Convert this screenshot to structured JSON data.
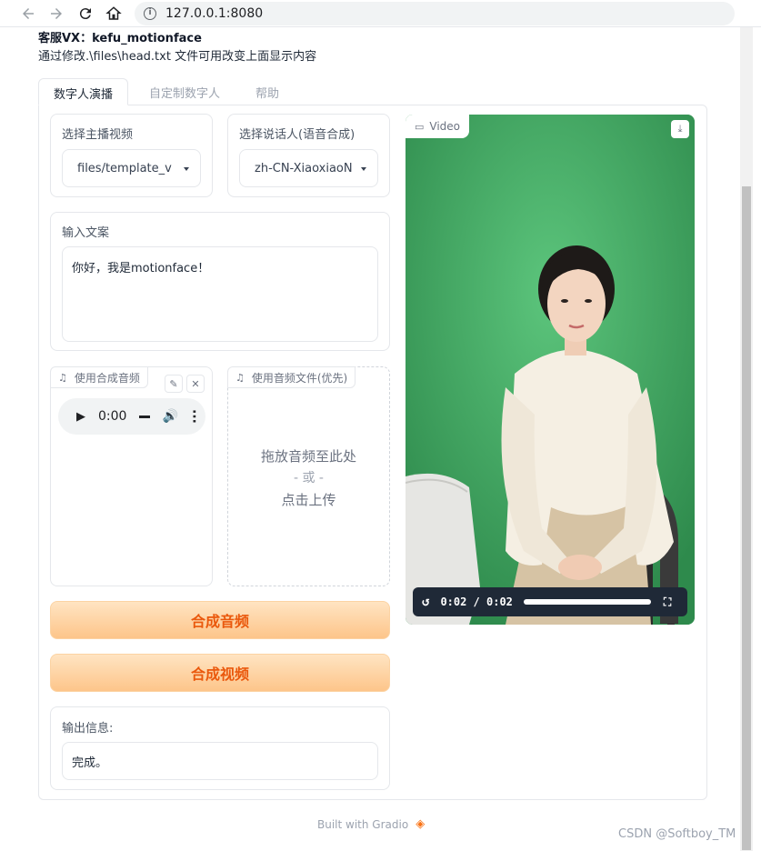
{
  "browser": {
    "url": "127.0.0.1:8080"
  },
  "header": {
    "line1": "客服VX：kefu_motionface",
    "line2": "通过修改.\\files\\head.txt 文件可用改变上面显示内容"
  },
  "tabs": [
    {
      "label": "数字人演播",
      "active": true
    },
    {
      "label": "自定制数字人",
      "active": false
    },
    {
      "label": "帮助",
      "active": false
    }
  ],
  "host_video": {
    "label": "选择主播视频",
    "value": "files/template_v"
  },
  "speaker": {
    "label": "选择说话人(语音合成)",
    "value": "zh-CN-XiaoxiaoN"
  },
  "script_input": {
    "label": "输入文案",
    "value": "你好，我是motionface！"
  },
  "synth_audio": {
    "label": "使用合成音频",
    "time": "0:00"
  },
  "upload_audio": {
    "label": "使用音频文件(优先)",
    "drop_line1": "拖放音频至此处",
    "drop_line2": "- 或 -",
    "drop_line3": "点击上传"
  },
  "buttons": {
    "synth_audio": "合成音频",
    "synth_video": "合成视频"
  },
  "output": {
    "label": "输出信息:",
    "value": "完成。"
  },
  "video": {
    "label": "Video",
    "time": "0:02 / 0:02",
    "progress": 1.0
  },
  "footer": {
    "text": "Built with Gradio"
  },
  "watermark": "CSDN @Softboy_TM",
  "colors": {
    "accent": "#ea580c",
    "button_gradient_top": "#ffe4c2",
    "button_gradient_bottom": "#fdc58a",
    "video_background": "#3fa35f"
  }
}
